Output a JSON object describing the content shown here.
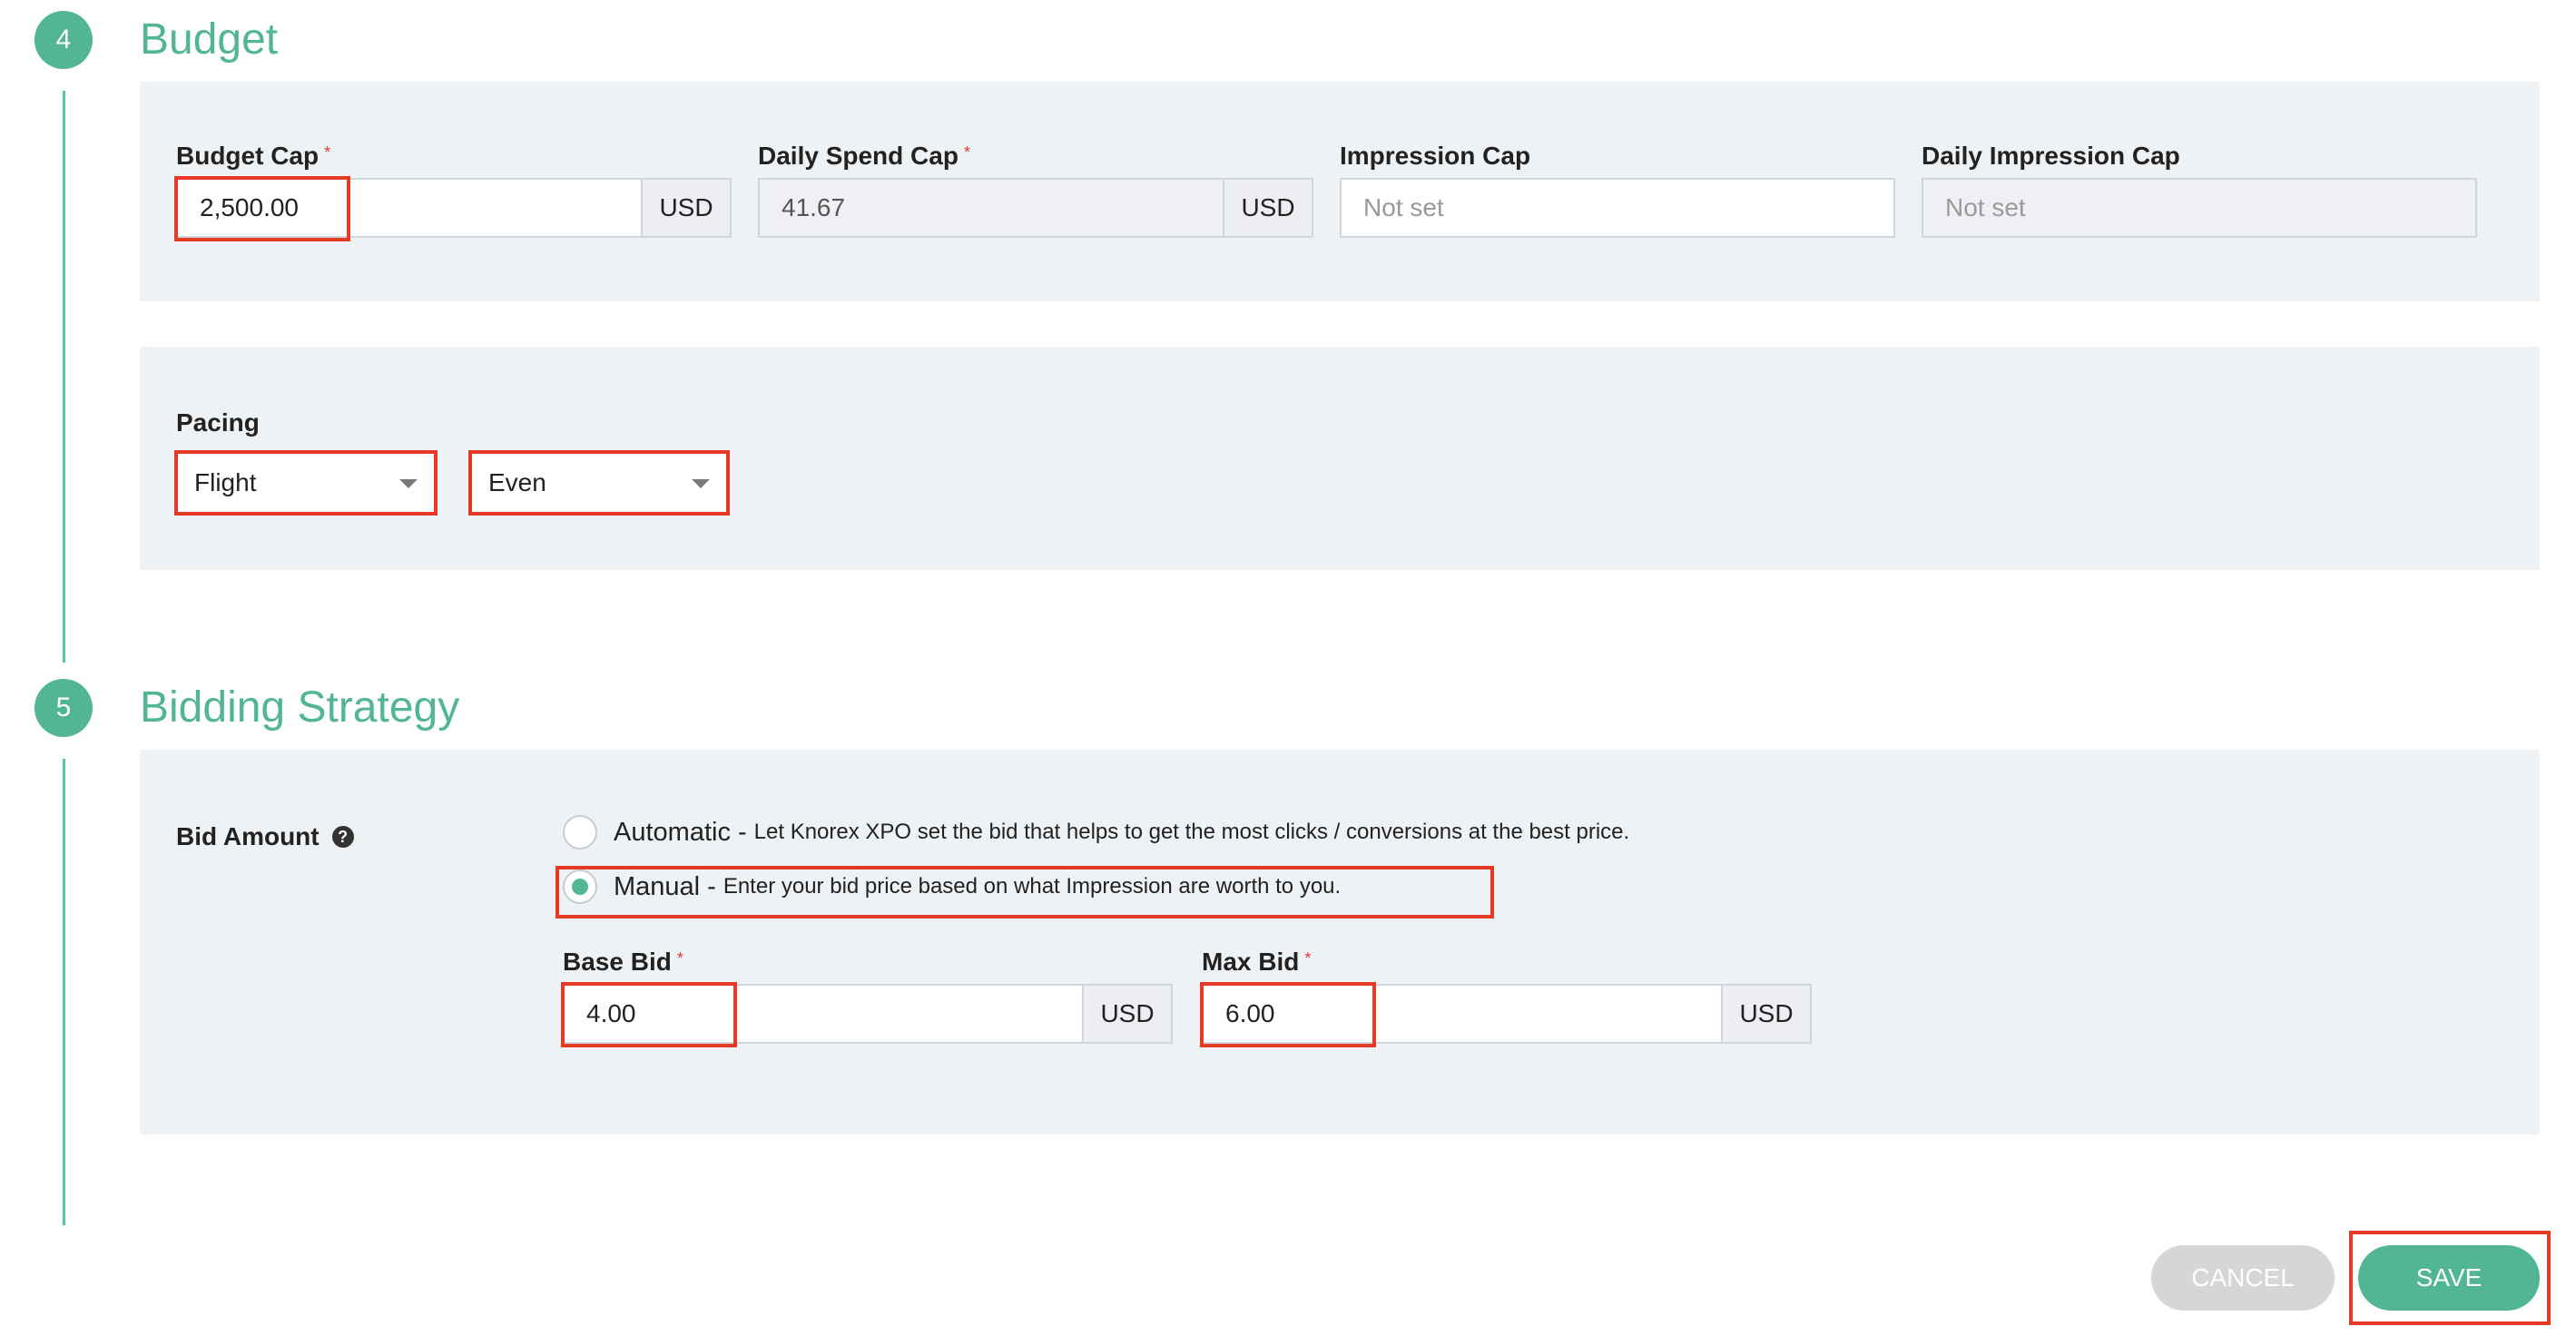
{
  "budget_section": {
    "step_number": "4",
    "title": "Budget",
    "budget_cap": {
      "label": "Budget Cap",
      "required": "*",
      "value": "2,500.00",
      "unit": "USD"
    },
    "daily_spend_cap": {
      "label": "Daily Spend Cap",
      "required": "*",
      "value": "41.67",
      "unit": "USD"
    },
    "impression_cap": {
      "label": "Impression Cap",
      "placeholder": "Not set"
    },
    "daily_impression_cap": {
      "label": "Daily Impression Cap",
      "placeholder": "Not set"
    },
    "pacing": {
      "label": "Pacing",
      "type_value": "Flight",
      "mode_value": "Even"
    }
  },
  "bidding_section": {
    "step_number": "5",
    "title": "Bidding Strategy",
    "bid_amount_label": "Bid Amount",
    "help_icon_glyph": "?",
    "options": {
      "automatic": {
        "title": "Automatic -",
        "description": "Let Knorex XPO set the bid that helps to get the most clicks / conversions at the best price.",
        "selected": false
      },
      "manual": {
        "title": "Manual -",
        "description": "Enter your bid price based on what Impression are worth to you.",
        "selected": true
      }
    },
    "base_bid": {
      "label": "Base Bid",
      "required": "*",
      "value": "4.00",
      "unit": "USD"
    },
    "max_bid": {
      "label": "Max Bid",
      "required": "*",
      "value": "6.00",
      "unit": "USD"
    }
  },
  "actions": {
    "cancel_label": "CANCEL",
    "save_label": "SAVE"
  },
  "colors": {
    "accent": "#52b596",
    "highlight": "#e53a25",
    "panel_bg": "#eff2f5"
  }
}
